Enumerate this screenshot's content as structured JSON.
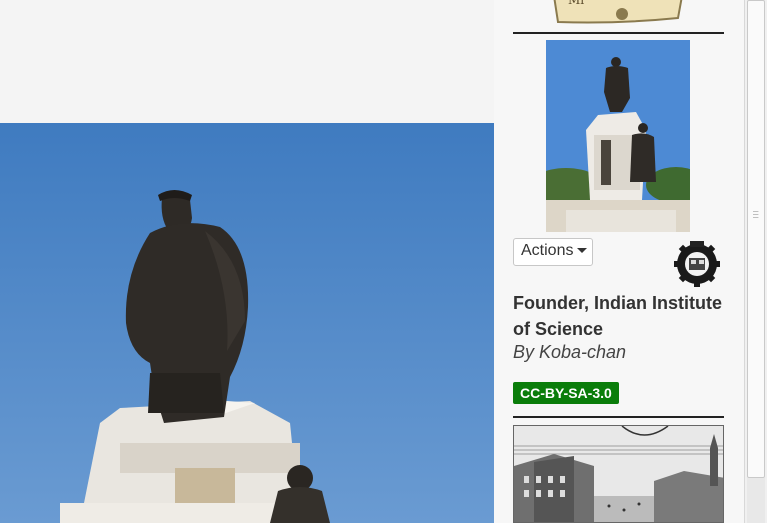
{
  "sidebar": {
    "actions_label": "Actions",
    "image_title": "Founder, Indian Institute of Science",
    "author": "By Koba-chan",
    "license": "CC-BY-SA-3.0",
    "badge_text": "Mi"
  },
  "colors": {
    "sky": "#4f86c3",
    "license_green": "#0a7d0a",
    "statue_bronze": "#2e2a26"
  }
}
